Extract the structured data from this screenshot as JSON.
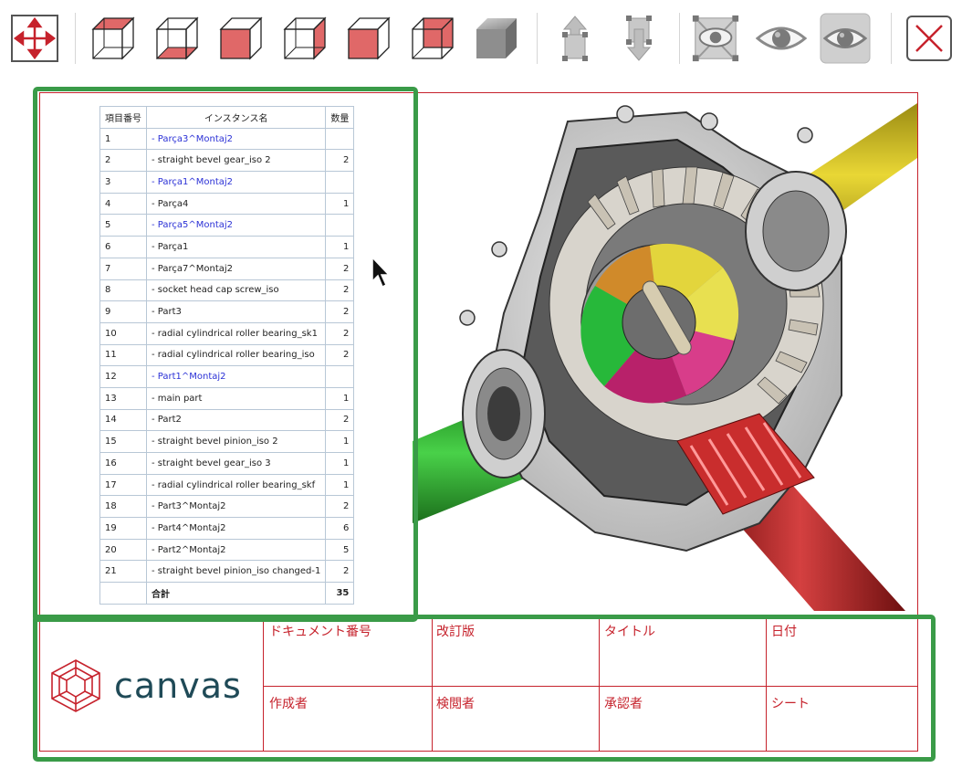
{
  "toolbar": {
    "buttons": [
      {
        "name": "fit-view-icon"
      },
      {
        "name": "view-cube-bottom-icon"
      },
      {
        "name": "view-cube-bottom-outline-icon"
      },
      {
        "name": "view-cube-left-icon"
      },
      {
        "name": "view-cube-right-icon"
      },
      {
        "name": "view-cube-front-icon"
      },
      {
        "name": "view-cube-back-icon"
      },
      {
        "name": "shaded-cube-icon"
      },
      {
        "name": "explode-up-icon"
      },
      {
        "name": "explode-down-icon"
      },
      {
        "name": "hide-selected-icon"
      },
      {
        "name": "show-icon"
      },
      {
        "name": "show-all-icon"
      },
      {
        "name": "close-icon"
      }
    ]
  },
  "bom": {
    "headers": {
      "no": "項目番号",
      "name": "インスタンス名",
      "qty": "数量"
    },
    "rows": [
      {
        "no": "1",
        "name": "- Parça3^Montaj2",
        "qty": "",
        "blue": true
      },
      {
        "no": "2",
        "name": "- straight bevel gear_iso 2",
        "qty": "2",
        "blue": false
      },
      {
        "no": "3",
        "name": "- Parça1^Montaj2",
        "qty": "",
        "blue": true
      },
      {
        "no": "4",
        "name": "- Parça4",
        "qty": "1",
        "blue": false
      },
      {
        "no": "5",
        "name": "- Parça5^Montaj2",
        "qty": "",
        "blue": true
      },
      {
        "no": "6",
        "name": "- Parça1",
        "qty": "1",
        "blue": false
      },
      {
        "no": "7",
        "name": "- Parça7^Montaj2",
        "qty": "2",
        "blue": false
      },
      {
        "no": "8",
        "name": "- socket head cap screw_iso",
        "qty": "2",
        "blue": false
      },
      {
        "no": "9",
        "name": "- Part3",
        "qty": "2",
        "blue": false
      },
      {
        "no": "10",
        "name": "- radial cylindrical roller bearing_sk1",
        "qty": "2",
        "blue": false
      },
      {
        "no": "11",
        "name": "- radial cylindrical roller bearing_iso",
        "qty": "2",
        "blue": false
      },
      {
        "no": "12",
        "name": "- Part1^Montaj2",
        "qty": "",
        "blue": true
      },
      {
        "no": "13",
        "name": "- main part",
        "qty": "1",
        "blue": false
      },
      {
        "no": "14",
        "name": "- Part2",
        "qty": "2",
        "blue": false
      },
      {
        "no": "15",
        "name": "- straight bevel pinion_iso 2",
        "qty": "1",
        "blue": false
      },
      {
        "no": "16",
        "name": "- straight bevel gear_iso 3",
        "qty": "1",
        "blue": false
      },
      {
        "no": "17",
        "name": "- radial cylindrical roller bearing_skf",
        "qty": "1",
        "blue": false
      },
      {
        "no": "18",
        "name": "- Part3^Montaj2",
        "qty": "2",
        "blue": false
      },
      {
        "no": "19",
        "name": "- Part4^Montaj2",
        "qty": "6",
        "blue": false
      },
      {
        "no": "20",
        "name": "- Part2^Montaj2",
        "qty": "5",
        "blue": false
      },
      {
        "no": "21",
        "name": "- straight bevel pinion_iso changed-1",
        "qty": "2",
        "blue": false
      }
    ],
    "total_label": "合計",
    "total_qty": "35"
  },
  "title_block": {
    "logo_text": "canvas",
    "document_number": "ドキュメント番号",
    "revision": "改訂版",
    "title": "タイトル",
    "date": "日付",
    "author": "作成者",
    "reviewer": "検閲者",
    "approver": "承認者",
    "sheet": "シート"
  },
  "colors": {
    "sheet_border": "#c6222c",
    "selection": "#3a9b48",
    "logo": "#1f4a57",
    "link_blue": "#2b31d6"
  }
}
